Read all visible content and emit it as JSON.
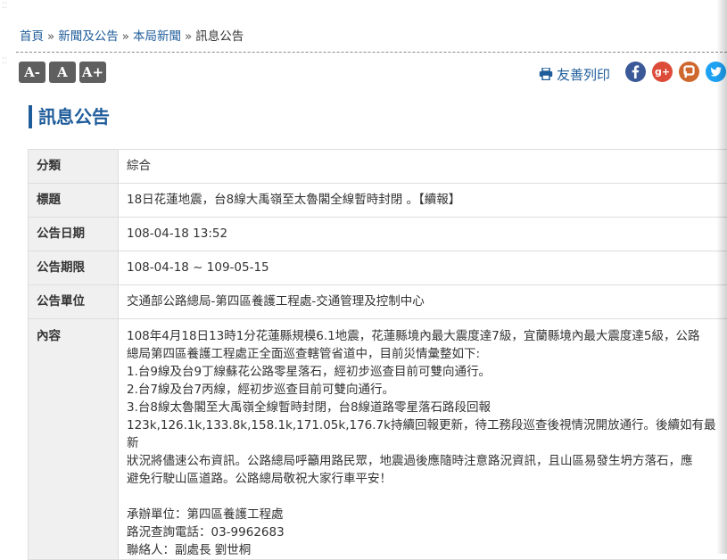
{
  "breadcrumb": {
    "items": [
      "首頁",
      "新聞及公告",
      "本局新聞",
      "訊息公告"
    ],
    "separator": "»"
  },
  "font_controls": {
    "smaller": "A-",
    "normal": "A",
    "larger": "A+"
  },
  "print": {
    "label": "友善列印",
    "icon": "printer-icon"
  },
  "social": [
    {
      "name": "facebook-icon",
      "color": "#3b5998"
    },
    {
      "name": "google-plus-icon",
      "color": "#dd4b39"
    },
    {
      "name": "plurk-icon",
      "color": "#cf682f"
    },
    {
      "name": "twitter-icon",
      "color": "#1da1f2"
    }
  ],
  "page": {
    "title": "訊息公告"
  },
  "fields": [
    {
      "label": "分類",
      "value": "綜合"
    },
    {
      "label": "標題",
      "value": "18日花蓮地震，台8線大禹嶺至太魯閣全線暫時封閉 。【續報】"
    },
    {
      "label": "公告日期",
      "value": "108-04-18 13:52"
    },
    {
      "label": "公告期限",
      "value": "108-04-18 ~ 109-05-15"
    },
    {
      "label": "公告單位",
      "value": "交通部公路總局-第四區養護工程處-交通管理及控制中心"
    }
  ],
  "content": {
    "label": "內容",
    "lines": [
      "108年4月18日13時1分花蓮縣規模6.1地震，花蓮縣境內最大震度達7級，宜蘭縣境內最大震度達5級，公路",
      "總局第四區養護工程處正全面巡查轄管省道中，目前災情彙整如下:",
      "1.台9線及台9丁線蘇花公路零星落石，經初步巡查目前可雙向通行。",
      "2.台7線及台7丙線，經初步巡查目前可雙向通行。",
      "3.台8線太魯閣至大禹嶺全線暫時封閉，台8線道路零星落石路段回報",
      "123k,126.1k,133.8k,158.1k,171.05k,176.7k持續回報更新，待工務段巡查後視情況開放通行。後續如有最新",
      "狀況將儘速公布資訊。公路總局呼籲用路民眾，地震過後應隨時注意路況資訊，且山區易發生坍方落石，應",
      "避免行駛山區道路。公路總局敬祝大家行車平安！"
    ],
    "contact_lines": [
      "承辦單位：第四區養護工程處",
      "路況查詢電話：03-9962683",
      "聯絡人：副處長 劉世桐"
    ]
  }
}
